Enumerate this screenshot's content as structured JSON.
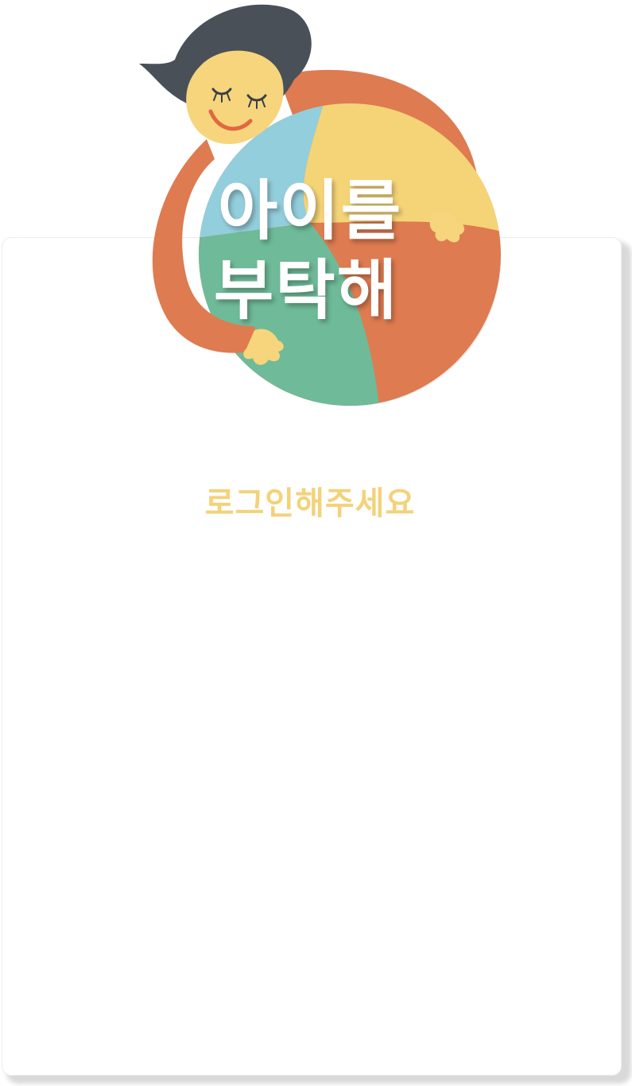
{
  "app": {
    "logo_line1": "아이를",
    "logo_line2": "부탁해",
    "logo_icon": "mother-hugging-child-illustration"
  },
  "main": {
    "login_prompt": "로그인해주세요"
  },
  "colors": {
    "prompt_text": "#f3d27a",
    "circle_blue": "#93cedc",
    "circle_yellow": "#f5d478",
    "circle_green": "#6fba98",
    "arm_orange": "#de7b50",
    "hair": "#4a5058",
    "skin": "#f6d57c"
  }
}
